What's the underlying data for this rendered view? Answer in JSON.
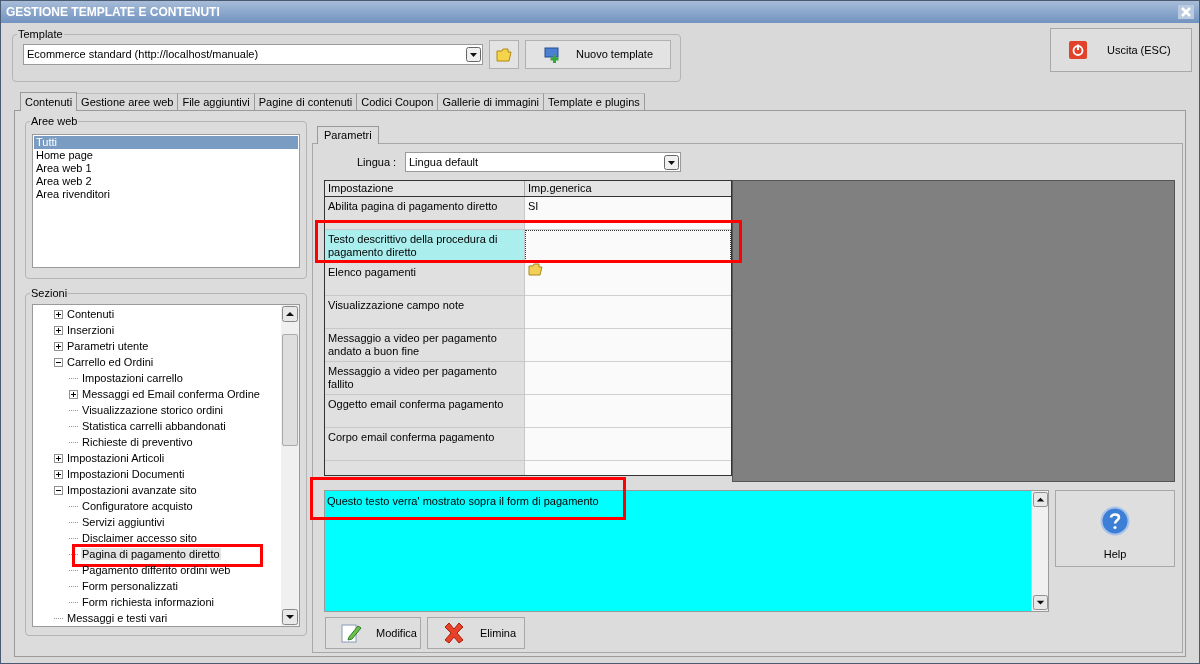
{
  "window": {
    "title": "GESTIONE TEMPLATE E CONTENUTI"
  },
  "template": {
    "label": "Template",
    "value": "Ecommerce standard (http://localhost/manuale)",
    "new_button": "Nuovo template"
  },
  "exit_button": "Uscita (ESC)",
  "tabs": [
    {
      "label": "Contenuti",
      "selected": true
    },
    {
      "label": "Gestione aree web",
      "selected": false
    },
    {
      "label": "File aggiuntivi",
      "selected": false
    },
    {
      "label": "Pagine di contenuti",
      "selected": false
    },
    {
      "label": "Codici Coupon",
      "selected": false
    },
    {
      "label": "Gallerie di immagini",
      "selected": false
    },
    {
      "label": "Template e plugins",
      "selected": false
    }
  ],
  "web_areas": {
    "label": "Aree web",
    "items": [
      {
        "label": "Tutti",
        "selected": true
      },
      {
        "label": "Home page",
        "selected": false
      },
      {
        "label": "Area web 1",
        "selected": false
      },
      {
        "label": "Area web 2",
        "selected": false
      },
      {
        "label": "Area rivenditori",
        "selected": false
      }
    ]
  },
  "sections": {
    "label": "Sezioni",
    "tree": [
      {
        "label": "Contenuti",
        "kind": "folder",
        "expanded": false,
        "selected": false,
        "highlighted": false
      },
      {
        "label": "Inserzioni",
        "kind": "folder",
        "expanded": false,
        "selected": false,
        "highlighted": false
      },
      {
        "label": "Parametri utente",
        "kind": "folder",
        "expanded": false,
        "selected": false,
        "highlighted": false
      },
      {
        "label": "Carrello ed Ordini",
        "kind": "folder",
        "expanded": true,
        "selected": false,
        "highlighted": false,
        "children": [
          {
            "label": "Impostazioni carrello",
            "kind": "leaf",
            "selected": false,
            "highlighted": false
          },
          {
            "label": "Messaggi ed Email conferma Ordine",
            "kind": "folder",
            "expanded": false,
            "selected": false,
            "highlighted": false
          },
          {
            "label": "Visualizzazione storico ordini",
            "kind": "leaf",
            "selected": false,
            "highlighted": false
          },
          {
            "label": "Statistica carrelli abbandonati",
            "kind": "leaf",
            "selected": false,
            "highlighted": false
          },
          {
            "label": "Richieste di preventivo",
            "kind": "leaf",
            "selected": false,
            "highlighted": false
          }
        ]
      },
      {
        "label": "Impostazioni Articoli",
        "kind": "folder",
        "expanded": false,
        "selected": false,
        "highlighted": false
      },
      {
        "label": "Impostazioni Documenti",
        "kind": "folder",
        "expanded": false,
        "selected": false,
        "highlighted": false
      },
      {
        "label": "Impostazioni avanzate sito",
        "kind": "folder",
        "expanded": true,
        "selected": false,
        "highlighted": false,
        "children": [
          {
            "label": "Configuratore acquisto",
            "kind": "leaf",
            "selected": false,
            "highlighted": false
          },
          {
            "label": "Servizi aggiuntivi",
            "kind": "leaf",
            "selected": false,
            "highlighted": false
          },
          {
            "label": "Disclaimer accesso sito",
            "kind": "leaf",
            "selected": false,
            "highlighted": false
          },
          {
            "label": "Pagina di pagamento diretto",
            "kind": "leaf",
            "selected": true,
            "highlighted": true
          },
          {
            "label": "Pagamento differito ordini web",
            "kind": "leaf",
            "selected": false,
            "highlighted": false
          },
          {
            "label": "Form personalizzati",
            "kind": "leaf",
            "selected": false,
            "highlighted": false
          },
          {
            "label": "Form richiesta informazioni",
            "kind": "leaf",
            "selected": false,
            "highlighted": false
          }
        ]
      },
      {
        "label": "Messaggi e testi vari",
        "kind": "leaf",
        "selected": false,
        "highlighted": false
      }
    ]
  },
  "params": {
    "tab": {
      "label": "Parametri",
      "selected": true
    },
    "language_label": "Lingua :",
    "language_value": "Lingua default",
    "columns": [
      "Impostazione",
      "Imp.generica"
    ],
    "rows": [
      {
        "setting": "Abilita pagina di pagamento diretto",
        "kind": "text",
        "value": "SI",
        "selected": false,
        "highlighted": false
      },
      {
        "setting": "Testo descrittivo della procedura di pagamento diretto",
        "kind": "text",
        "selected": true,
        "highlighted": true
      },
      {
        "setting": "Elenco pagamenti",
        "kind": "icon",
        "selected": false,
        "highlighted": false
      },
      {
        "setting": "Visualizzazione campo note",
        "kind": "text",
        "selected": false,
        "highlighted": false
      },
      {
        "setting": "Messaggio a video per pagamento andato a buon fine",
        "kind": "text",
        "selected": false,
        "highlighted": false
      },
      {
        "setting": "Messaggio a video per pagamento fallito",
        "kind": "text",
        "selected": false,
        "highlighted": false
      },
      {
        "setting": "Oggetto email conferma pagamento",
        "kind": "text",
        "selected": false,
        "highlighted": false
      },
      {
        "setting": "Corpo email conferma pagamento",
        "kind": "text",
        "selected": false,
        "highlighted": false
      }
    ]
  },
  "editor": {
    "text": "Questo testo verra' mostrato sopra il form di pagamento",
    "highlighted": true
  },
  "help_button": "Help",
  "buttons": [
    {
      "label": "Modifica",
      "kind": "edit"
    },
    {
      "label": "Elimina",
      "kind": "delete"
    }
  ]
}
